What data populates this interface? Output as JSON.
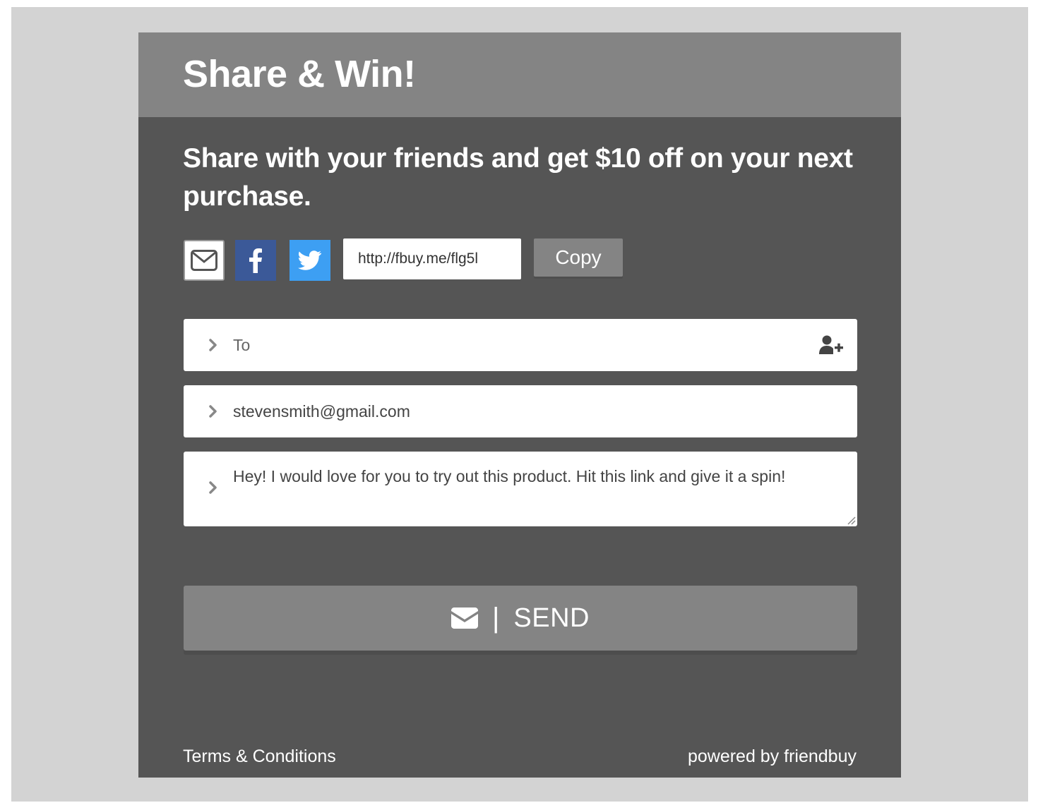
{
  "header": {
    "title": "Share & Win!"
  },
  "subtitle": "Share with your friends and get $10 off on your next purchase.",
  "share": {
    "icons": {
      "email": "envelope-icon",
      "facebook": "facebook-icon",
      "twitter": "twitter-icon"
    },
    "link_value": "http://fbuy.me/flg5l",
    "copy_label": "Copy"
  },
  "form": {
    "to_placeholder": "To",
    "from_value": "stevensmith@gmail.com",
    "message_value": "Hey! I would love for you to try out this product. Hit this link and give it a spin!"
  },
  "send": {
    "separator": "|",
    "label": "SEND",
    "icon": "envelope-icon"
  },
  "footer": {
    "terms_label": "Terms & Conditions",
    "powered_label": "powered by friendbuy"
  },
  "colors": {
    "page_bg": "#d3d3d3",
    "widget_bg": "#555555",
    "header_bg": "#848484",
    "facebook": "#3b5998",
    "twitter": "#3d9ff3"
  }
}
